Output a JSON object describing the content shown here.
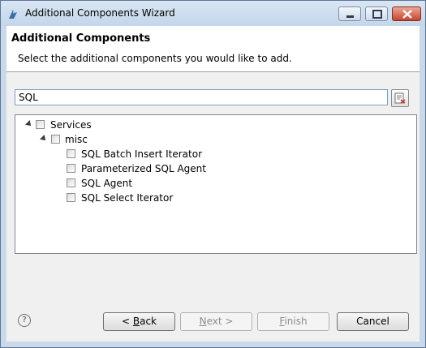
{
  "window": {
    "title": "Additional Components Wizard"
  },
  "header": {
    "title": "Additional Components",
    "description": "Select the additional components you would like to add."
  },
  "search": {
    "value": "SQL"
  },
  "tree": {
    "root_label": "Services",
    "folder_label": "misc",
    "items": [
      {
        "label": "SQL Batch Insert Iterator",
        "checked": false
      },
      {
        "label": "Parameterized SQL Agent",
        "checked": false
      },
      {
        "label": "SQL Agent",
        "checked": false
      },
      {
        "label": "SQL Select Iterator",
        "checked": false
      }
    ]
  },
  "footer": {
    "help_icon": "question-icon",
    "back_prefix": "< ",
    "back_mnemonic": "B",
    "back_rest": "ack",
    "next_mnemonic": "N",
    "next_rest": "ext >",
    "finish_mnemonic": "F",
    "finish_rest": "inish",
    "cancel_label": "Cancel"
  }
}
